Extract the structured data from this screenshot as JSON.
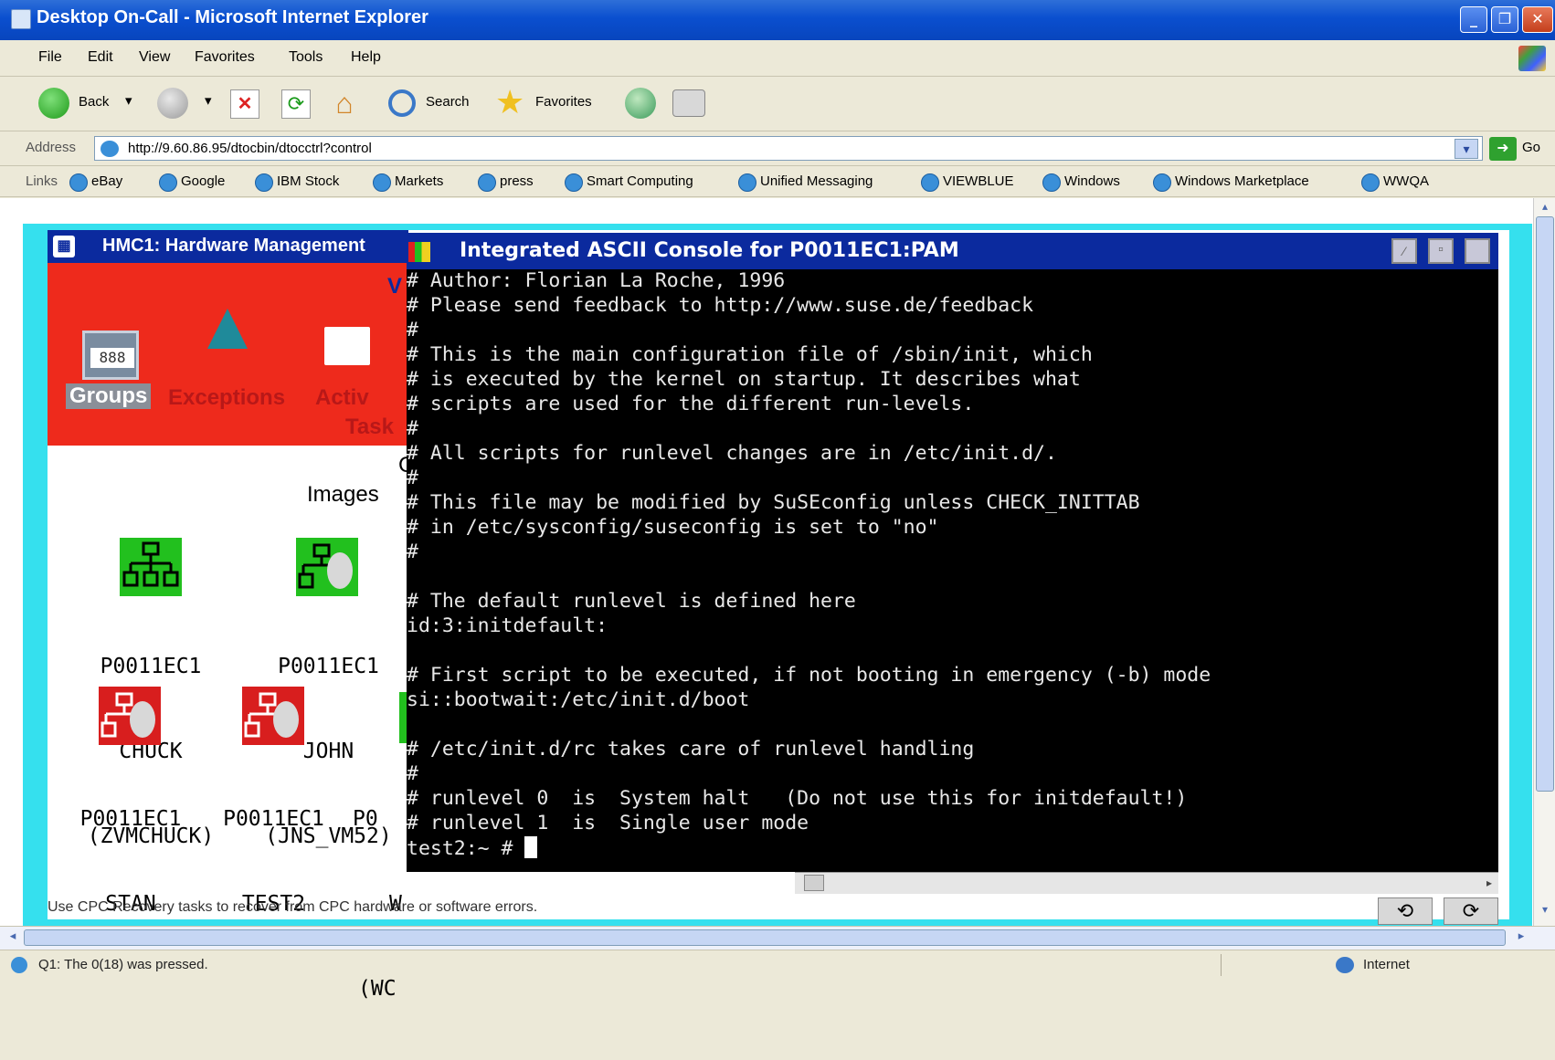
{
  "window": {
    "title": "Desktop On-Call - Microsoft Internet Explorer"
  },
  "menu": [
    "File",
    "Edit",
    "View",
    "Favorites",
    "Tools",
    "Help"
  ],
  "toolbar": {
    "back": "Back",
    "search": "Search",
    "favorites": "Favorites"
  },
  "address": {
    "label": "Address",
    "url": "http://9.60.86.95/dtocbin/dtocctrl?control",
    "go": "Go"
  },
  "links": {
    "label": "Links",
    "items": [
      "eBay",
      "Google",
      "IBM Stock",
      "Markets",
      "press",
      "Smart Computing",
      "Unified Messaging",
      "VIEWBLUE",
      "Windows",
      "Windows Marketplace",
      "WWQA"
    ]
  },
  "hmc": {
    "title": "HMC1: Hardware Management",
    "nav": {
      "groups": "Groups",
      "exceptions": "Exceptions",
      "active_1": "Activ",
      "active_2": "Task",
      "v": "V"
    },
    "images_title": "Images",
    "images_frag": "C",
    "images": [
      {
        "line1": "P0011EC1",
        "line2": "CHUCK",
        "line3": "(ZVMCHUCK)",
        "status": "green"
      },
      {
        "line1": "P0011EC1",
        "line2": "JOHN",
        "line3": "(JNS_VM52)",
        "status": "green"
      },
      {
        "line1": "P0011EC1",
        "line2": "STAN",
        "line3": "",
        "status": "red"
      },
      {
        "line1": "P0011EC1",
        "line2": "TEST2",
        "line3": "",
        "status": "red"
      },
      {
        "line1": "P0",
        "line2": "W",
        "line3": "(WC",
        "status": "green"
      }
    ],
    "status_text": "Use CPC Recovery tasks to recover from CPC hardware or software errors."
  },
  "console": {
    "title": "Integrated ASCII Console for P0011EC1:PAM",
    "lines": [
      "# Author: Florian La Roche, 1996",
      "# Please send feedback to http://www.suse.de/feedback",
      "#",
      "# This is the main configuration file of /sbin/init, which",
      "# is executed by the kernel on startup. It describes what",
      "# scripts are used for the different run-levels.",
      "#",
      "# All scripts for runlevel changes are in /etc/init.d/.",
      "#",
      "# This file may be modified by SuSEconfig unless CHECK_INITTAB",
      "# in /etc/sysconfig/suseconfig is set to \"no\"",
      "#",
      "",
      "# The default runlevel is defined here",
      "id:3:initdefault:",
      "",
      "# First script to be executed, if not booting in emergency (-b) mode",
      "si::bootwait:/etc/init.d/boot",
      "",
      "# /etc/init.d/rc takes care of runlevel handling",
      "#",
      "# runlevel 0  is  System halt   (Do not use this for initdefault!)",
      "# runlevel 1  is  Single user mode"
    ],
    "prompt": "test2:~ # "
  },
  "statusbar": {
    "text": "Q1: The 0(18) was pressed.",
    "zone": "Internet"
  },
  "colors": {
    "hmc_red": "#ee2a1c",
    "title_blue": "#0b2a9e",
    "frame_aqua": "#35e0ee",
    "status_green": "#22c01e",
    "status_red": "#d81e1e"
  }
}
